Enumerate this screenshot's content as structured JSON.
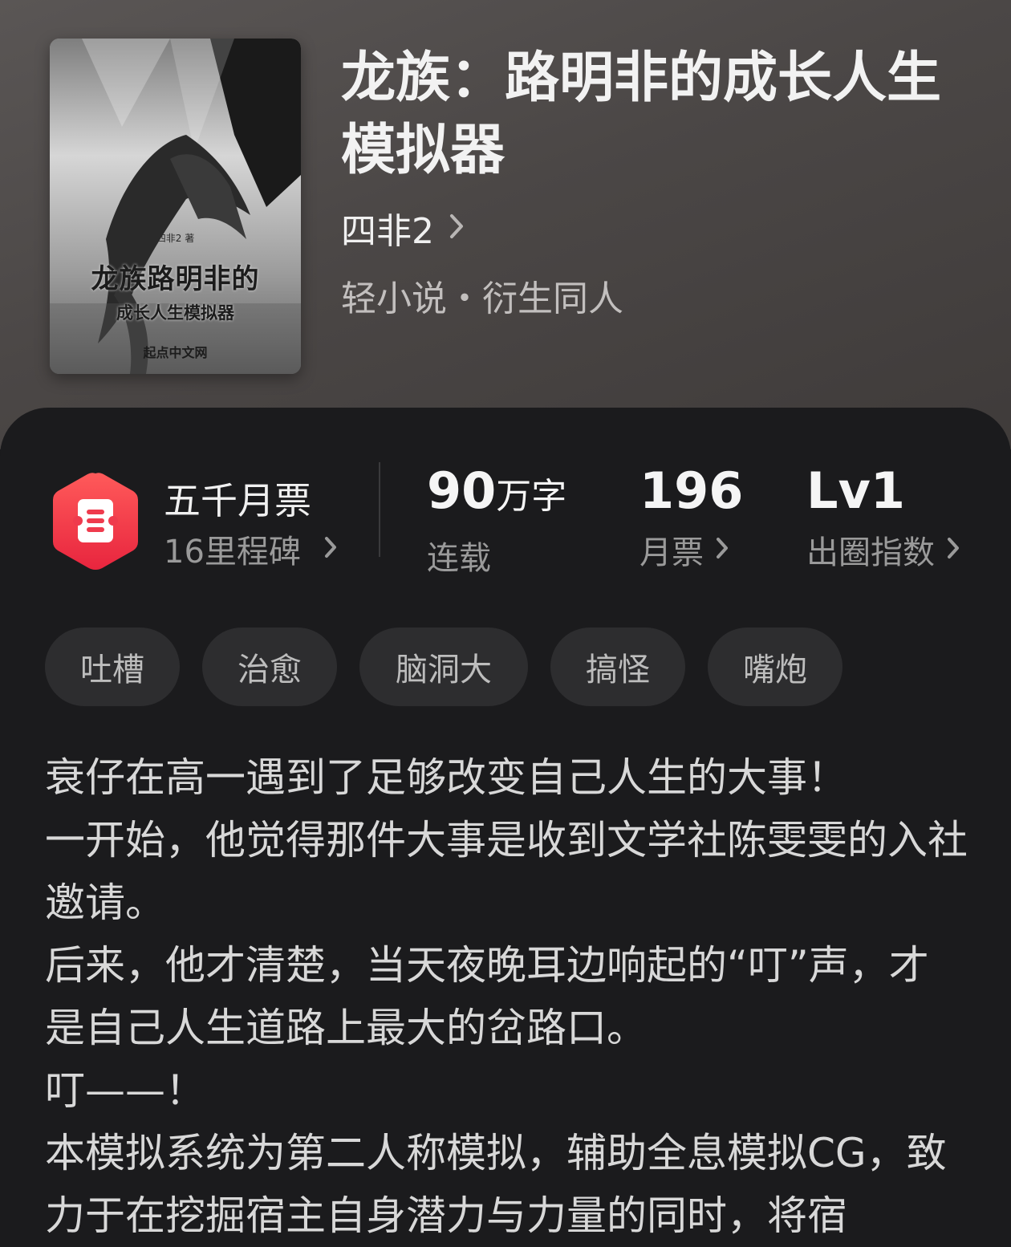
{
  "book": {
    "title": "龙族：路明非的成长人生模拟器",
    "author": "四非2",
    "category": "轻小说・衍生同人"
  },
  "cover": {
    "author_line": "四非2 著",
    "title_line1": "龙族路明非的",
    "title_line2": "成长人生模拟器",
    "publisher": "起点中文网"
  },
  "monthly_ticket": {
    "title": "五千月票",
    "subtitle": "16里程碑",
    "icon": "ticket-icon",
    "accent": "#ef3b4d"
  },
  "stats": [
    {
      "value": "90",
      "unit": "万字",
      "label": "连载",
      "has_arrow": false
    },
    {
      "value": "196",
      "unit": "",
      "label": "月票",
      "has_arrow": true
    },
    {
      "value": "Lv1",
      "unit": "",
      "label": "出圈指数",
      "has_arrow": true
    }
  ],
  "tags": [
    "吐槽",
    "治愈",
    "脑洞大",
    "搞怪",
    "嘴炮"
  ],
  "synopsis": [
    "衰仔在高一遇到了足够改变自己人生的大事！",
    "一开始，他觉得那件大事是收到文学社陈雯雯的入社邀请。",
    "后来，他才清楚，当天夜晚耳边响起的“叮”声，才是自己人生道路上最大的岔路口。",
    "叮——！",
    "本模拟系统为第二人称模拟，辅助全息模拟CG，致力于在挖掘宿主自身潜力与力量的同时，将宿"
  ]
}
